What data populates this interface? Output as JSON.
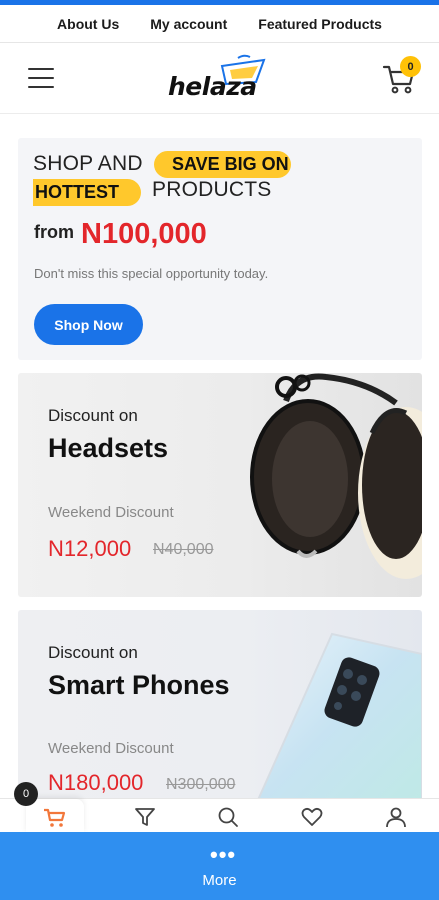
{
  "top_links": [
    "About Us",
    "My account",
    "Featured Products"
  ],
  "header": {
    "logo_text": "helaza",
    "cart_count": "0"
  },
  "hero": {
    "line1_a": "SHOP AND",
    "line1_highlight": "SAVE BIG ON",
    "line2_highlight": "HOTTEST",
    "line2_b": "PRODUCTS",
    "from_label": "from",
    "price": "N100,000",
    "subtitle": "Don't miss this special opportunity today.",
    "button_label": "Shop Now"
  },
  "promos": [
    {
      "small": "Discount on",
      "title": "Headsets",
      "weekend": "Weekend Discount",
      "price": "N12,000",
      "old_price": "N40,000"
    },
    {
      "small": "Discount on",
      "title": "Smart Phones",
      "weekend": "Weekend Discount",
      "price": "N180,000",
      "old_price": "N300,000"
    }
  ],
  "bottom_nav": {
    "cart_badge": "0",
    "items": [
      "cart-icon",
      "filter-icon",
      "search-icon",
      "heart-icon",
      "user-icon"
    ],
    "more_dots": "•••",
    "more_label": "More"
  },
  "colors": {
    "brand_blue": "#1a73e8",
    "accent_yellow": "#ffc82c",
    "price_red": "#e3262b",
    "active_orange": "#f2773b"
  }
}
